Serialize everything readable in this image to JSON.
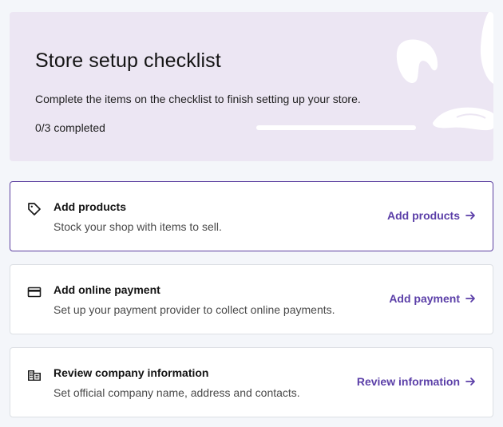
{
  "banner": {
    "title": "Store setup checklist",
    "description": "Complete the items on the checklist to finish setting up your store.",
    "progress_text": "0/3 completed",
    "completed": 0,
    "total": 3
  },
  "tasks": [
    {
      "icon": "tag-icon",
      "title": "Add products",
      "description": "Stock your shop with items to sell.",
      "action_label": "Add products",
      "active": true
    },
    {
      "icon": "credit-card-icon",
      "title": "Add online payment",
      "description": "Set up your payment provider to collect online payments.",
      "action_label": "Add payment",
      "active": false
    },
    {
      "icon": "building-icon",
      "title": "Review company information",
      "description": "Set official company name, address and contacts.",
      "action_label": "Review information",
      "active": false
    }
  ],
  "colors": {
    "accent": "#5b3fa8",
    "banner_bg": "#ece6f3",
    "active_border": "#5c3fa0",
    "page_bg": "#f4f6fa"
  }
}
